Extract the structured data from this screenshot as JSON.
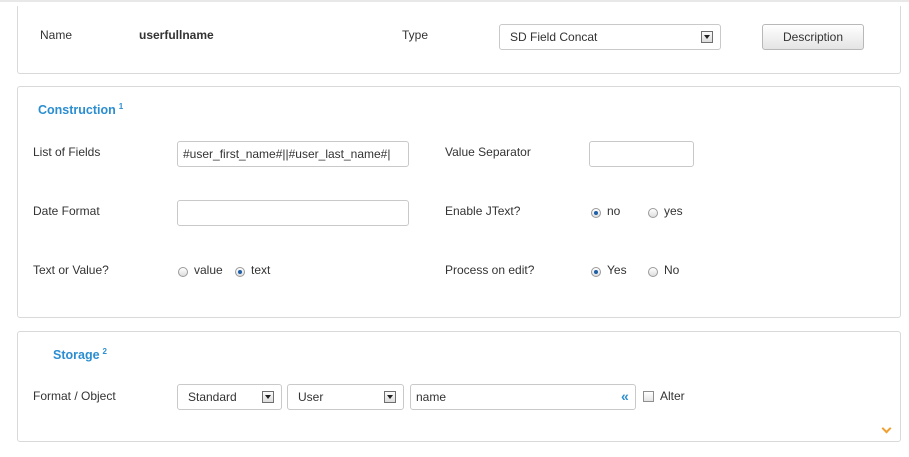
{
  "header": {
    "name_label": "Name",
    "name_value": "userfullname",
    "type_label": "Type",
    "type_selected": "SD Field Concat",
    "description_button": "Description"
  },
  "construction": {
    "title": "Construction",
    "footnote": "1",
    "list_of_fields_label": "List of Fields",
    "list_of_fields_value": "#user_first_name#||#user_last_name#|",
    "value_separator_label": "Value Separator",
    "value_separator_value": "",
    "date_format_label": "Date Format",
    "date_format_value": "",
    "enable_jtext_label": "Enable JText?",
    "enable_jtext_options": [
      "no",
      "yes"
    ],
    "enable_jtext_selected": "no",
    "text_or_value_label": "Text or Value?",
    "text_or_value_options": [
      "value",
      "text"
    ],
    "text_or_value_selected": "text",
    "process_on_edit_label": "Process on edit?",
    "process_on_edit_options": [
      "Yes",
      "No"
    ],
    "process_on_edit_selected": "Yes"
  },
  "storage": {
    "title": "Storage",
    "footnote": "2",
    "format_object_label": "Format / Object",
    "format_selected": "Standard",
    "object_selected": "User",
    "field_value": "name",
    "alter_label": "Alter",
    "alter_checked": false
  },
  "colors": {
    "accent": "#2b8ed1",
    "chevron": "#f0a030",
    "border": "#d9d9d9"
  }
}
